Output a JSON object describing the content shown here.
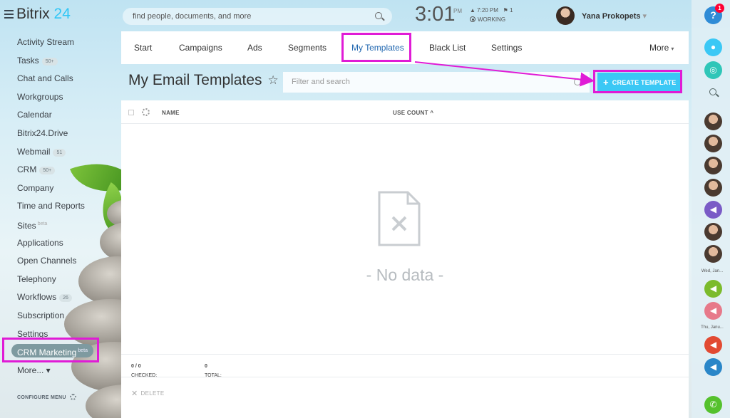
{
  "app": {
    "logo_name": "Bitrix",
    "logo_number": "24"
  },
  "search": {
    "placeholder": "find people, documents, and more"
  },
  "clock": {
    "time": "3:01",
    "ampm": "PM",
    "alarm": "▲ 7:20 PM",
    "flag": "⚑ 1",
    "status": "WORKING"
  },
  "user": {
    "name": "Yana Prokopets"
  },
  "nav": {
    "items": [
      {
        "label": "Activity Stream",
        "badge": ""
      },
      {
        "label": "Tasks",
        "badge": "50+"
      },
      {
        "label": "Chat and Calls",
        "badge": ""
      },
      {
        "label": "Workgroups",
        "badge": ""
      },
      {
        "label": "Calendar",
        "badge": ""
      },
      {
        "label": "Bitrix24.Drive",
        "badge": ""
      },
      {
        "label": "Webmail",
        "badge": "51"
      },
      {
        "label": "CRM",
        "badge": "50+"
      },
      {
        "label": "Company",
        "badge": ""
      },
      {
        "label": "Time and Reports",
        "badge": ""
      },
      {
        "label": "Sites",
        "badge": "",
        "beta": "beta"
      },
      {
        "label": "Applications",
        "badge": ""
      },
      {
        "label": "Open Channels",
        "badge": ""
      },
      {
        "label": "Telephony",
        "badge": ""
      },
      {
        "label": "Workflows",
        "badge": "26"
      },
      {
        "label": "Subscription",
        "badge": ""
      },
      {
        "label": "Settings",
        "badge": ""
      }
    ],
    "active": {
      "label": "CRM Marketing",
      "beta": "beta"
    },
    "more": "More... ▾",
    "configure": "CONFIGURE MENU"
  },
  "tabs": {
    "start": "Start",
    "campaigns": "Campaigns",
    "ads": "Ads",
    "segments": "Segments",
    "my_templates": "My Templates",
    "black_list": "Black List",
    "settings": "Settings",
    "more": "More"
  },
  "page": {
    "title": "My Email Templates",
    "star": "☆",
    "filter_placeholder": "Filter and search",
    "create_button": "CREATE TEMPLATE"
  },
  "grid": {
    "col_name": "NAME",
    "col_use_count": "USE COUNT ^",
    "empty": "- No data -",
    "checked_label": "CHECKED:",
    "checked_value": "0 / 0",
    "total_label": "TOTAL:",
    "total_value": "0",
    "delete": "DELETE"
  },
  "rightbar": {
    "help": "?",
    "help_count": "1",
    "date1": "Wed, Jan...",
    "date2": "Thu, Janu..."
  },
  "colors": {
    "accent": "#3bc8f5",
    "highlight": "#e01bd6",
    "tab_active": "#2067b0"
  }
}
